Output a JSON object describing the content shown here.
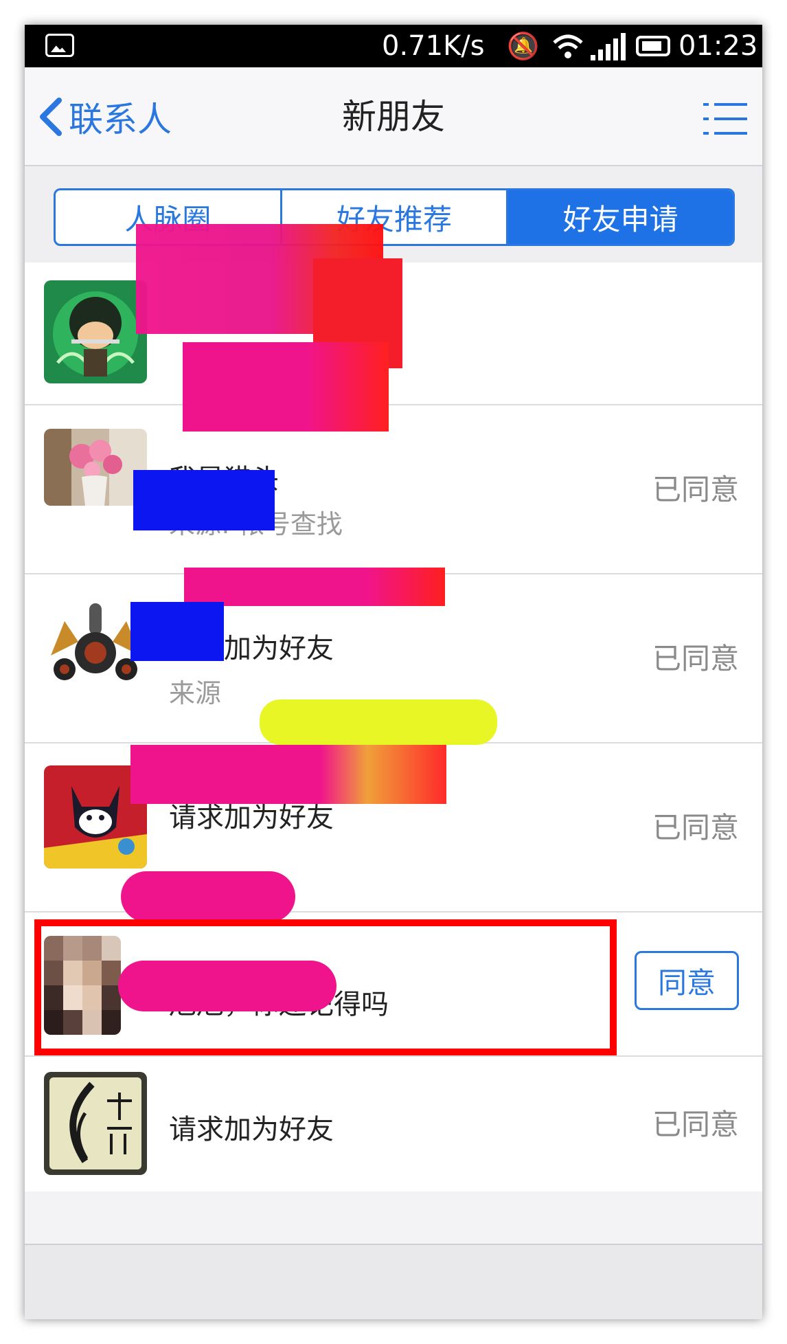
{
  "status_bar": {
    "speed": "0.71K/s",
    "time": "01:23",
    "icons": [
      "image-icon",
      "mute-icon",
      "wifi-icon",
      "signal-icon",
      "battery-icon"
    ]
  },
  "nav": {
    "back_label": "联系人",
    "title": "新朋友",
    "back_icon": "chevron-left-icon",
    "menu_icon": "list-menu-icon",
    "accent": "#2a77e0"
  },
  "tabs": [
    {
      "label": "人脉圈",
      "active": false
    },
    {
      "label": "好友推荐",
      "active": false
    },
    {
      "label": "好友申请",
      "active": true
    }
  ],
  "requests": [
    {
      "message": "",
      "source": "",
      "status": ""
    },
    {
      "message": "我是猎头",
      "source": "来源: 帐号查找",
      "status": "已同意"
    },
    {
      "message": "请求加为好友",
      "source": "来源",
      "status": "已同意"
    },
    {
      "message": "请求加为好友",
      "source": "",
      "status": "已同意"
    },
    {
      "message": "旭旭，你还记得吗",
      "source": "",
      "action": "同意"
    },
    {
      "message": "请求加为好友",
      "source": "",
      "status": "已同意"
    }
  ],
  "colors": {
    "redaction_pink": "#f0148c",
    "redaction_blue": "#0b16f0",
    "redaction_yellow": "#e8f51a",
    "highlight": "#ff0000"
  }
}
